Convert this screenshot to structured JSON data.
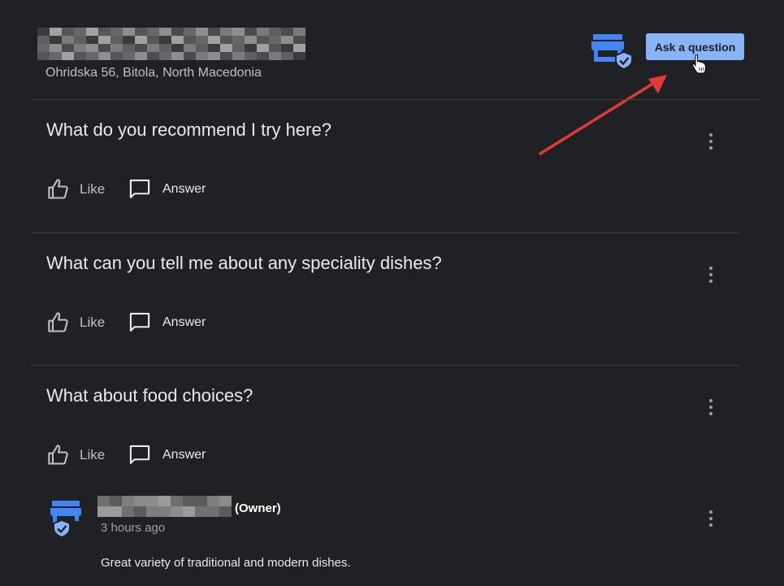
{
  "business": {
    "address": "Ohridska 56, Bitola, North Macedonia",
    "ask_button_label": "Ask a question"
  },
  "colors": {
    "background": "#202124",
    "accent": "#8ab4f8",
    "store_icon": "#4285f4",
    "annotation_arrow": "#e53935",
    "divider": "#3c4043"
  },
  "icons": {
    "store_badge": "verified-store-icon",
    "like": "thumb-up-icon",
    "answer": "chat-bubble-icon",
    "more": "more-vertical-icon",
    "cursor": "hand-pointer-icon",
    "annotation": "red-arrow-icon"
  },
  "questions": [
    {
      "text": "What do you recommend I try here?",
      "like_label": "Like",
      "answer_label": "Answer"
    },
    {
      "text": "What can you tell me about any speciality dishes?",
      "like_label": "Like",
      "answer_label": "Answer"
    },
    {
      "text": "What about food choices?",
      "like_label": "Like",
      "answer_label": "Answer",
      "answers": [
        {
          "role_tag": "(Owner)",
          "time": "3 hours ago",
          "text": "Great variety of traditional and modern dishes."
        }
      ]
    }
  ]
}
